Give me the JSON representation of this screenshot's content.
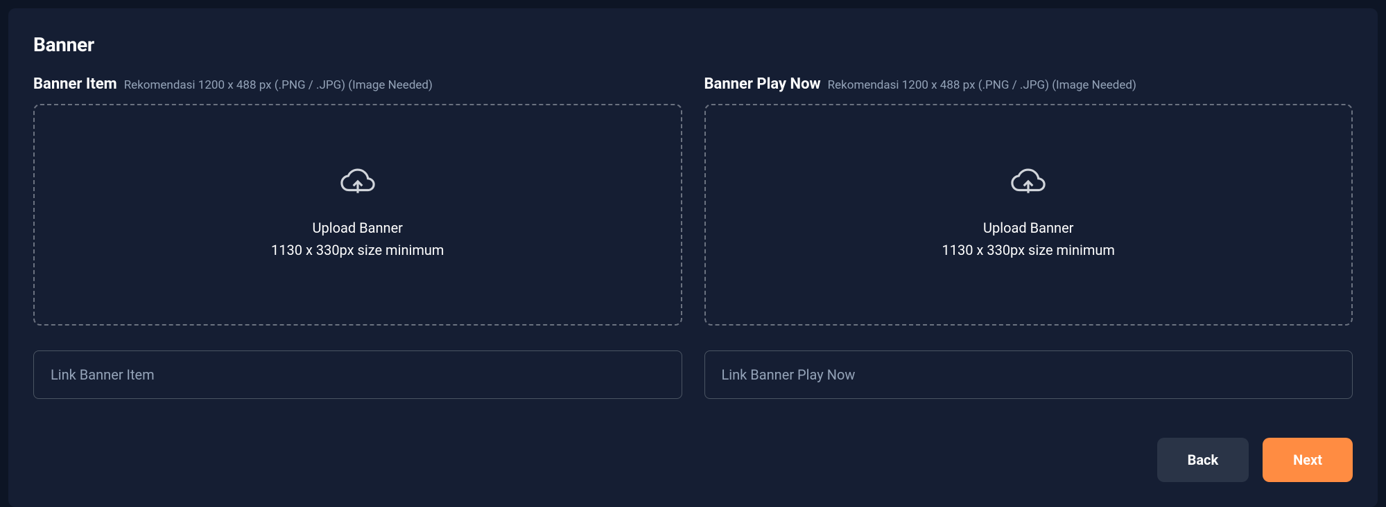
{
  "section": {
    "title": "Banner"
  },
  "left": {
    "label": "Banner Item",
    "hint": "Rekomendasi 1200 x 488 px (.PNG / .JPG) (Image Needed)",
    "dropzone": {
      "line1": "Upload Banner",
      "line2": "1130 x 330px size minimum"
    },
    "placeholder": "Link Banner Item"
  },
  "right": {
    "label": "Banner Play Now",
    "hint": "Rekomendasi 1200 x 488 px (.PNG / .JPG) (Image Needed)",
    "dropzone": {
      "line1": "Upload Banner",
      "line2": "1130 x 330px size minimum"
    },
    "placeholder": "Link Banner Play Now"
  },
  "buttons": {
    "back": "Back",
    "next": "Next"
  }
}
